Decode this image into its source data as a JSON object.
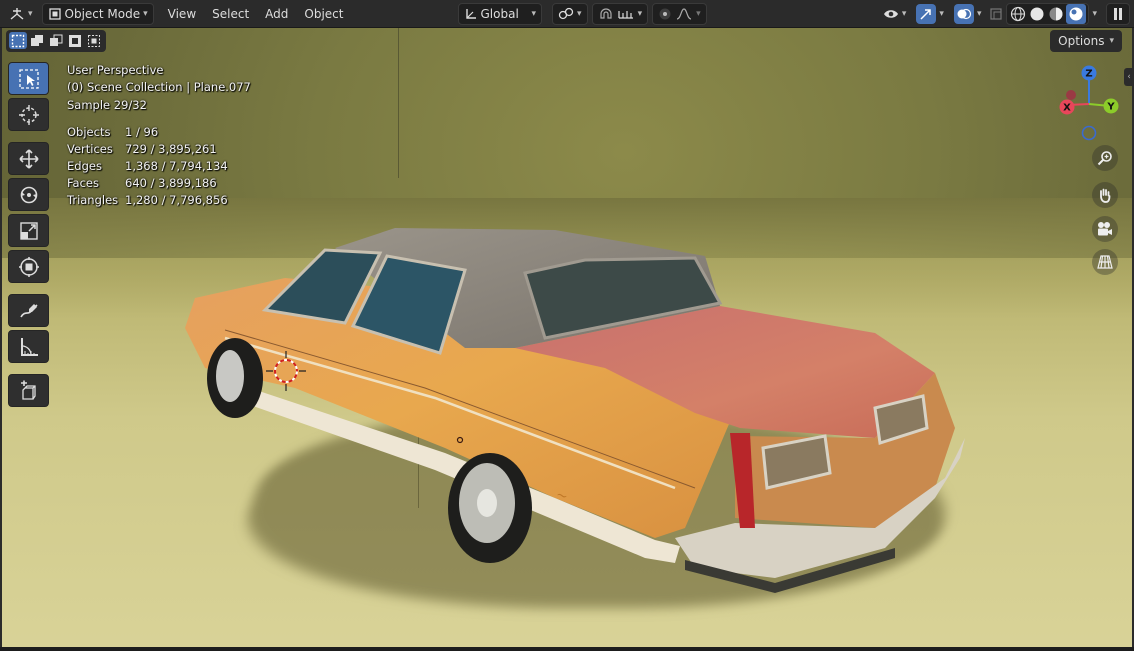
{
  "header": {
    "editor_type_icon": "axes-editor-icon",
    "mode_label": "Object Mode",
    "menus": [
      "View",
      "Select",
      "Add",
      "Object"
    ],
    "orientation_label": "Global",
    "pivot_icon": "pivot-link-icon",
    "snap_icon": "magnet-icon",
    "proportional_icon": "dot-circle-icon"
  },
  "viewport": {
    "options_label": "Options",
    "overlay_lines": [
      "User Perspective",
      "(0) Scene Collection | Plane.077",
      "Sample 29/32"
    ],
    "stats": [
      {
        "label": "Objects",
        "value": "1 / 96"
      },
      {
        "label": "Vertices",
        "value": "729 / 3,895,261"
      },
      {
        "label": "Edges",
        "value": "1,368 / 7,794,134"
      },
      {
        "label": "Faces",
        "value": "640 / 3,899,186"
      },
      {
        "label": "Triangles",
        "value": "1,280 / 7,796,856"
      }
    ],
    "gizmo": {
      "x": "X",
      "y": "Y",
      "z": "Z"
    },
    "colors": {
      "accent": "#4772b3",
      "axis_x": "#e8465a",
      "axis_y": "#8ccc2a",
      "axis_z": "#3a7ae0"
    }
  }
}
